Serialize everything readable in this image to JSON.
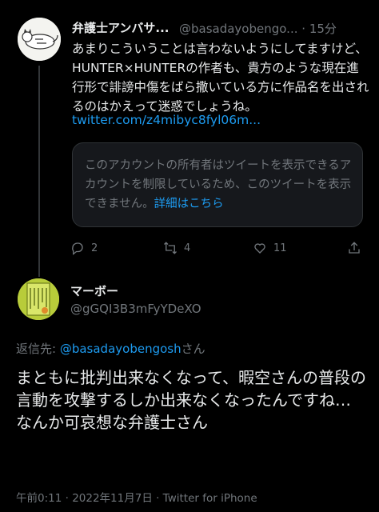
{
  "parent_tweet": {
    "display_name": "弁護士アンバサ...",
    "handle": "@basadayobengo...",
    "separator": "·",
    "time": "15分",
    "text": "あまりこういうことは言わないようにしてますけど、HUNTER×HUNTERの作者も、貴方のような現在進行形で誹謗中傷をばら撒いている方に作品名を出されるのはかえって迷惑でしょうね。",
    "link": "twitter.com/z4mibyc8fyl06m...",
    "quote_notice": "このアカウントの所有者はツイートを表示できるアカウントを制限しているため、このツイートを表示できません。",
    "quote_more": "詳細はこちら",
    "actions": {
      "reply_icon": "reply-icon",
      "reply_count": "2",
      "retweet_icon": "retweet-icon",
      "retweet_count": "4",
      "like_icon": "heart-icon",
      "like_count": "11",
      "share_icon": "share-icon"
    }
  },
  "reply_tweet": {
    "display_name": "マーボー",
    "handle": "@gGQI3B3mFyYDeXO",
    "reply_to_prefix": "返信先: ",
    "reply_to_handle": "@basadayobengosh",
    "reply_to_suffix": "さん",
    "text": "まともに批判出来なくなって、暇空さんの普段の言動を攻撃するしか出来なくなったんですね…\nなんか可哀想な弁護士さん",
    "meta": "午前0:11 · 2022年11月7日 · Twitter for iPhone"
  },
  "colors": {
    "background": "#000000",
    "text": "#e7e9ea",
    "muted": "#71767b",
    "link": "#1d9bf0"
  }
}
